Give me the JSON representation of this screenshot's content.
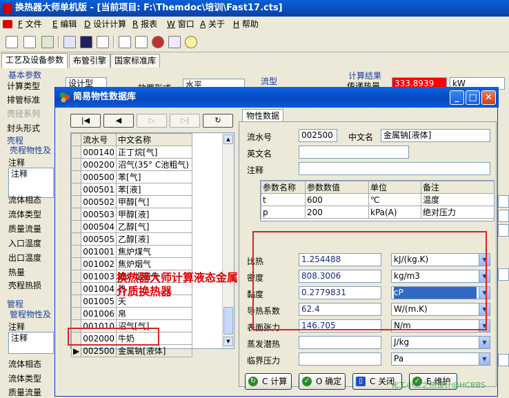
{
  "main_window": {
    "title": "换热器大师单机版 - [当前项目: F:\\Themdoc\\培训\\Fast17.cts]"
  },
  "menu": [
    {
      "key": "F",
      "label": "文件"
    },
    {
      "key": "E",
      "label": "编辑"
    },
    {
      "key": "D",
      "label": "设计计算"
    },
    {
      "key": "R",
      "label": "报表"
    },
    {
      "key": "W",
      "label": "窗口"
    },
    {
      "key": "A",
      "label": "关于"
    },
    {
      "key": "H",
      "label": "帮助"
    }
  ],
  "main_tabs": [
    "工艺及设备参数",
    "布管引擎",
    "国家标准库"
  ],
  "left_panel": {
    "basic_group": "基本参数",
    "calc_type_label": "计算类型",
    "calc_type_value": "设计型",
    "tube_std_label": "排管标准",
    "shell_series_label": "壳径系列",
    "head_form_label": "封头形式",
    "place_form_label": "放置形式",
    "place_form_value": "水平",
    "flow_label": "流型",
    "result_group": "计算结果",
    "heat_label": "传递热量",
    "heat_value": "333.8939",
    "heat_unit": "kW",
    "shell_group": "壳程",
    "shell_props": "壳程物性及",
    "note_label": "注释",
    "note_value": "注释",
    "fields": [
      "流体相态",
      "流体类型",
      "质量流量",
      "入口温度",
      "出口温度",
      "热量",
      "壳程热损"
    ],
    "tube_group": "管程",
    "tube_props": "管程物性及",
    "tube_note_label": "注释",
    "tube_note_value": "注释",
    "tube_fields": [
      "流体相态",
      "流体类型",
      "质量流量"
    ]
  },
  "dialog": {
    "title": "简易物性数据库",
    "list_headers": [
      "流水号",
      "中文名称"
    ],
    "list_rows": [
      {
        "id": "000140",
        "name": "正丁烷[气]"
      },
      {
        "id": "000200",
        "name": "沼气(35° C池粗气)"
      },
      {
        "id": "000500",
        "name": "苯[气]"
      },
      {
        "id": "000501",
        "name": "苯[液]"
      },
      {
        "id": "000502",
        "name": "甲醇[气]"
      },
      {
        "id": "000503",
        "name": "甲醇[液]"
      },
      {
        "id": "000504",
        "name": "乙醇[气]"
      },
      {
        "id": "000505",
        "name": "乙醇[液]"
      },
      {
        "id": "001001",
        "name": "焦炉煤气"
      },
      {
        "id": "001002",
        "name": "焦炉烟气"
      },
      {
        "id": "001003",
        "name": "铁炉烟道气"
      },
      {
        "id": "001004",
        "name": "热"
      },
      {
        "id": "001005",
        "name": "天"
      },
      {
        "id": "001006",
        "name": "帛"
      },
      {
        "id": "001010",
        "name": "沼气[气]"
      },
      {
        "id": "002000",
        "name": "牛奶"
      },
      {
        "id": "002500",
        "name": "金属钠[液体]"
      }
    ],
    "prop_tab": "物性数据",
    "serial_label": "流水号",
    "serial_value": "002500",
    "cn_name_label": "中文名",
    "cn_name_value": "金属钠[液体]",
    "en_name_label": "英文名",
    "note_label": "注释",
    "param_headers": [
      "参数名称",
      "参数数值",
      "单位",
      "备注"
    ],
    "params": [
      {
        "name": "t",
        "value": "600",
        "unit": "℃",
        "remark": "温度"
      },
      {
        "name": "p",
        "value": "200",
        "unit": "kPa(A)",
        "remark": "绝对压力"
      }
    ],
    "props": [
      {
        "label": "比热",
        "value": "1.254488",
        "unit": "kJ/(kg.K)"
      },
      {
        "label": "密度",
        "value": "808.3006",
        "unit": "kg/m3"
      },
      {
        "label": "黏度",
        "value": "0.2779831",
        "unit": "cP"
      },
      {
        "label": "导热系数",
        "value": "62.4",
        "unit": "W/(m.K)"
      },
      {
        "label": "表面张力",
        "value": "146.705",
        "unit": "N/m"
      },
      {
        "label": "蒸发潜热",
        "value": "",
        "unit": "J/kg"
      },
      {
        "label": "临界压力",
        "value": "",
        "unit": "Pa"
      }
    ],
    "buttons": {
      "calc": "C 计算",
      "ok": "O 确定",
      "close": "C 关闭",
      "maintain": "E 维护"
    }
  },
  "annotation": "换热器大师计算液态金属介质换热器",
  "watermark": "化工小二之热设计@HCBBS"
}
